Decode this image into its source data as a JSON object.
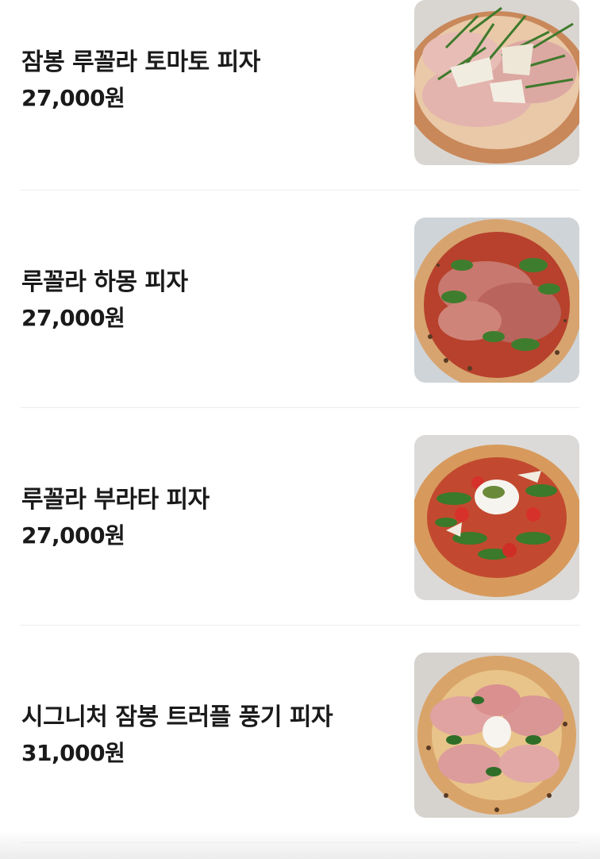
{
  "menu": {
    "items": [
      {
        "name": "잠봉 루꼴라 토마토 피자",
        "price": "27,000원",
        "photo": "pizza-prosciutto-arugula-parmesan"
      },
      {
        "name": "루꼴라 하몽 피자",
        "price": "27,000원",
        "photo": "pizza-jamon-arugula"
      },
      {
        "name": "루꼴라 부라타 피자",
        "price": "27,000원",
        "photo": "pizza-burrata-arugula-tomato"
      },
      {
        "name": "시그니처 잠봉 트러플 풍기 피자",
        "price": "31,000원",
        "photo": "pizza-jambon-truffle-funghi"
      }
    ]
  }
}
